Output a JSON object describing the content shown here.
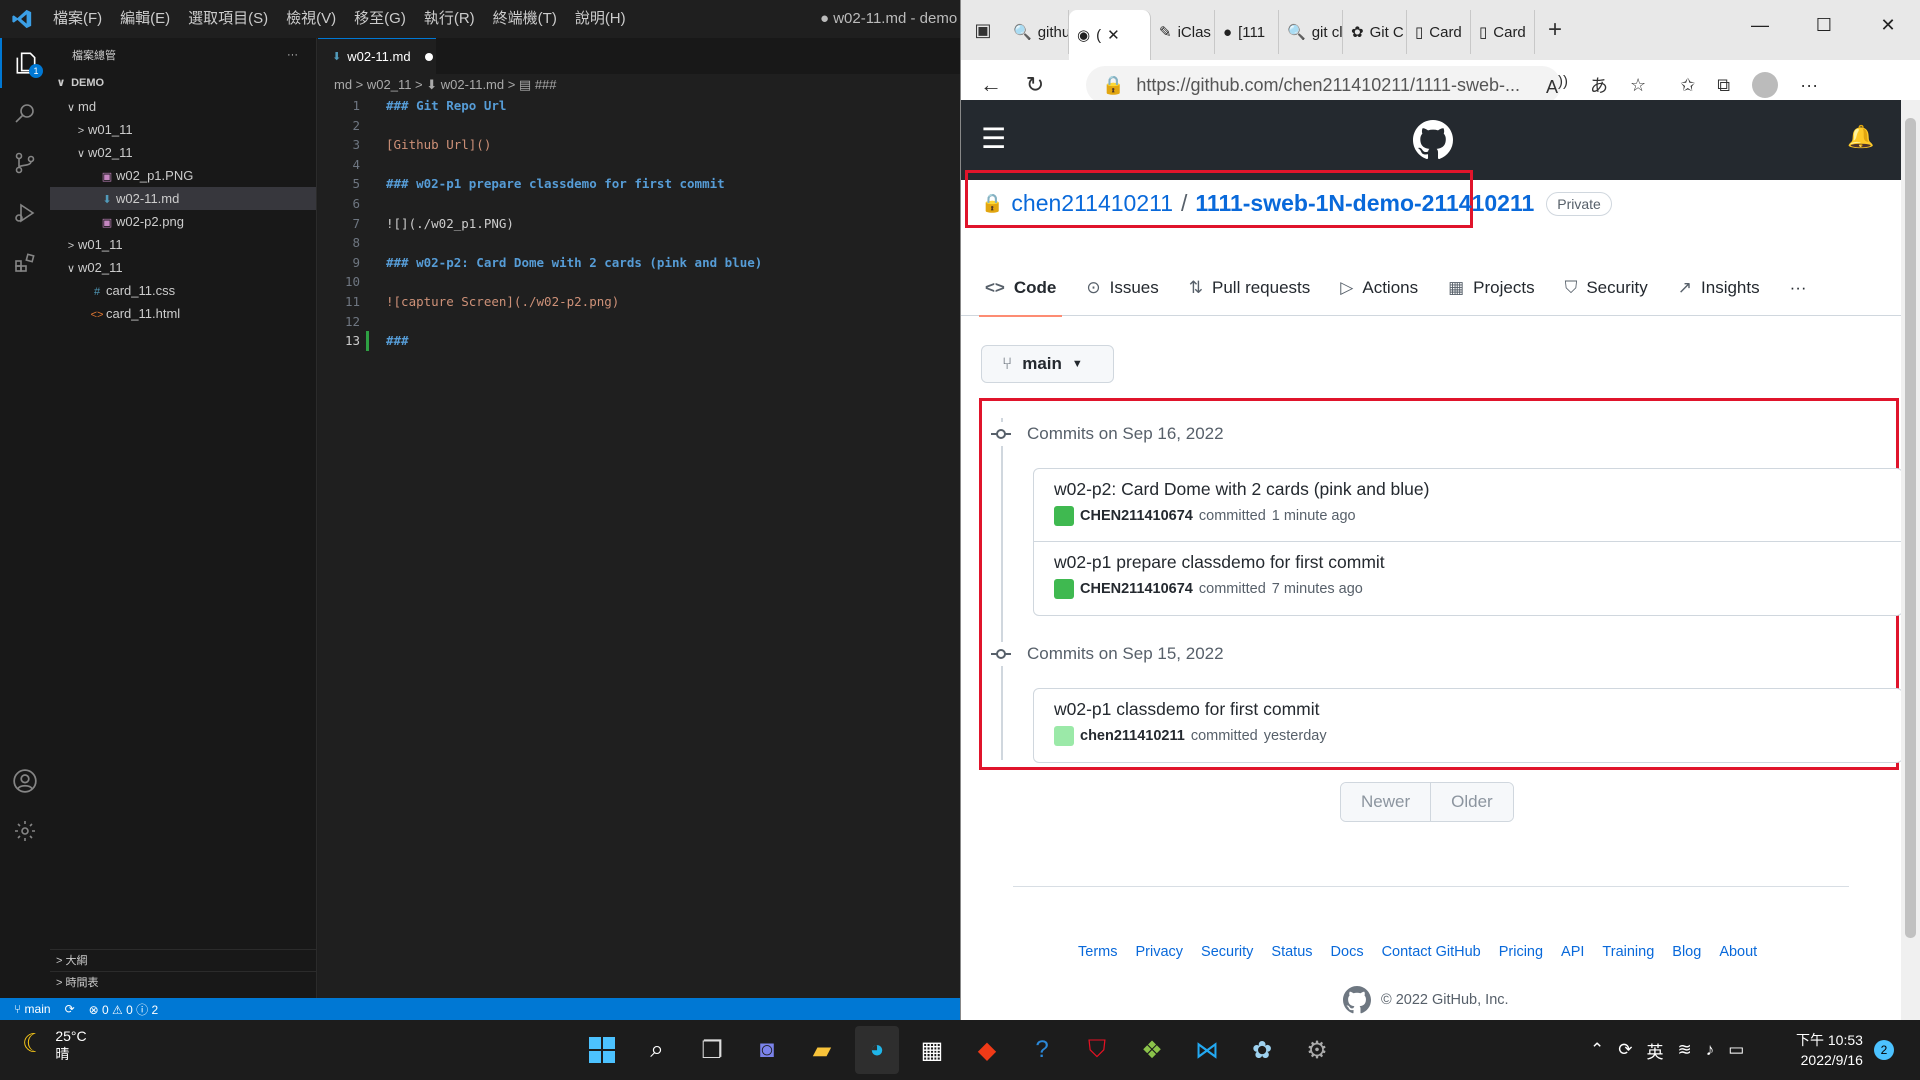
{
  "vscode": {
    "menu": [
      "檔案(F)",
      "編輯(E)",
      "選取項目(S)",
      "檢視(V)",
      "移至(G)",
      "執行(R)",
      "終端機(T)",
      "說明(H)"
    ],
    "window_title": "● w02-11.md - demo",
    "explorer_badge": "1",
    "sidebar": {
      "title": "檔案總管",
      "more": "···",
      "root": "DEMO",
      "tree": [
        {
          "label": "md",
          "chev": "∨",
          "indent": 1,
          "icon": "",
          "color": "#ccc"
        },
        {
          "label": "w01_11",
          "chev": ">",
          "indent": 2,
          "icon": "",
          "color": "#ccc"
        },
        {
          "label": "w02_11",
          "chev": "∨",
          "indent": 2,
          "icon": "",
          "color": "#ccc"
        },
        {
          "label": "w02_p1.PNG",
          "chev": "",
          "indent": 3,
          "icon": "▣",
          "color": "#c586c0"
        },
        {
          "label": "w02-11.md",
          "chev": "",
          "indent": 3,
          "icon": "⬇",
          "color": "#519aba",
          "selected": true
        },
        {
          "label": "w02-p2.png",
          "chev": "",
          "indent": 3,
          "icon": "▣",
          "color": "#c586c0"
        },
        {
          "label": "w01_11",
          "chev": ">",
          "indent": 1,
          "icon": "",
          "color": "#ccc"
        },
        {
          "label": "w02_11",
          "chev": "∨",
          "indent": 1,
          "icon": "",
          "color": "#ccc"
        },
        {
          "label": "card_11.css",
          "chev": "",
          "indent": 2,
          "icon": "#",
          "color": "#519aba"
        },
        {
          "label": "card_11.html",
          "chev": "",
          "indent": 2,
          "icon": "<>",
          "color": "#e37933"
        }
      ],
      "outline": "大綱",
      "timeline": "時間表"
    },
    "editor": {
      "tab_label": "w02-11.md",
      "breadcrumb": "md  >  w02_11  >  ⬇  w02-11.md  >  ▤  ###",
      "lines": [
        {
          "n": "1",
          "text": "### Git Repo Url",
          "kind": "h"
        },
        {
          "n": "2",
          "text": "",
          "kind": "p"
        },
        {
          "n": "3",
          "text": "[Github Url]()",
          "kind": "link"
        },
        {
          "n": "4",
          "text": "",
          "kind": "p"
        },
        {
          "n": "5",
          "text": "### w02-p1 prepare classdemo for first commit",
          "kind": "h"
        },
        {
          "n": "6",
          "text": "",
          "kind": "p"
        },
        {
          "n": "7",
          "text": "![](./w02_p1.PNG)",
          "kind": "img"
        },
        {
          "n": "8",
          "text": "",
          "kind": "p"
        },
        {
          "n": "9",
          "text": "### w02-p2: Card Dome with 2 cards (pink and blue)",
          "kind": "h"
        },
        {
          "n": "10",
          "text": "",
          "kind": "p"
        },
        {
          "n": "11",
          "text": "![capture Screen](./w02-p2.png)",
          "kind": "img2"
        },
        {
          "n": "12",
          "text": "",
          "kind": "p"
        },
        {
          "n": "13",
          "text": "###",
          "kind": "h",
          "current": true
        }
      ]
    },
    "status": {
      "branch": "main",
      "sync": "⟳",
      "problems": "⊗ 0 ⚠ 0 ⓘ 2"
    }
  },
  "edge": {
    "tabs": [
      {
        "icon": "🔍",
        "label": "githu"
      },
      {
        "icon": "◉",
        "label": "(",
        "active": true,
        "close": "✕"
      },
      {
        "icon": "✎",
        "label": "iClas"
      },
      {
        "icon": "●",
        "label": "[111"
      },
      {
        "icon": "🔍",
        "label": "git cl"
      },
      {
        "icon": "✿",
        "label": "Git C"
      },
      {
        "icon": "▯",
        "label": "Card"
      },
      {
        "icon": "▯",
        "label": "Card"
      }
    ],
    "new_tab": "+",
    "window_controls": [
      "—",
      "☐",
      "✕"
    ],
    "url": "https://github.com/chen211410211/1111-sweb-...",
    "nav": {
      "back": "←",
      "refresh": "↻"
    }
  },
  "github": {
    "owner": "chen211410211",
    "separator": "/",
    "repo": "1111-sweb-1N-demo-211410211",
    "visibility": "Private",
    "nav": [
      {
        "icon": "<>",
        "label": "Code",
        "active": true
      },
      {
        "icon": "⊙",
        "label": "Issues"
      },
      {
        "icon": "⇅",
        "label": "Pull requests"
      },
      {
        "icon": "▷",
        "label": "Actions"
      },
      {
        "icon": "▦",
        "label": "Projects"
      },
      {
        "icon": "⛉",
        "label": "Security"
      },
      {
        "icon": "↗",
        "label": "Insights"
      }
    ],
    "nav_more": "···",
    "branch": "main",
    "commit_groups": [
      {
        "date_label": "Commits on Sep 16, 2022",
        "commits": [
          {
            "message": "w02-p2: Card Dome with 2 cards (pink and blue)",
            "author": "CHEN211410674",
            "action": "committed",
            "time": "1 minute ago",
            "avatar_color": "#3fb950"
          },
          {
            "message": "w02-p1 prepare classdemo for first commit",
            "author": "CHEN211410674",
            "action": "committed",
            "time": "7 minutes ago",
            "avatar_color": "#3fb950"
          }
        ]
      },
      {
        "date_label": "Commits on Sep 15, 2022",
        "commits": [
          {
            "message": "w02-p1 classdemo for first commit",
            "author": "chen211410211",
            "action": "committed",
            "time": "yesterday",
            "avatar_color": "#9be9a8"
          }
        ]
      }
    ],
    "pager": {
      "newer": "Newer",
      "older": "Older"
    },
    "footer_links": [
      "Terms",
      "Privacy",
      "Security",
      "Status",
      "Docs",
      "Contact GitHub",
      "Pricing",
      "API",
      "Training",
      "Blog",
      "About"
    ],
    "copyright": "© 2022 GitHub, Inc."
  },
  "taskbar": {
    "temperature": "25°C",
    "weather": "晴",
    "ime": "英",
    "time": "下午 10:53",
    "date": "2022/9/16",
    "notifications": "2"
  }
}
